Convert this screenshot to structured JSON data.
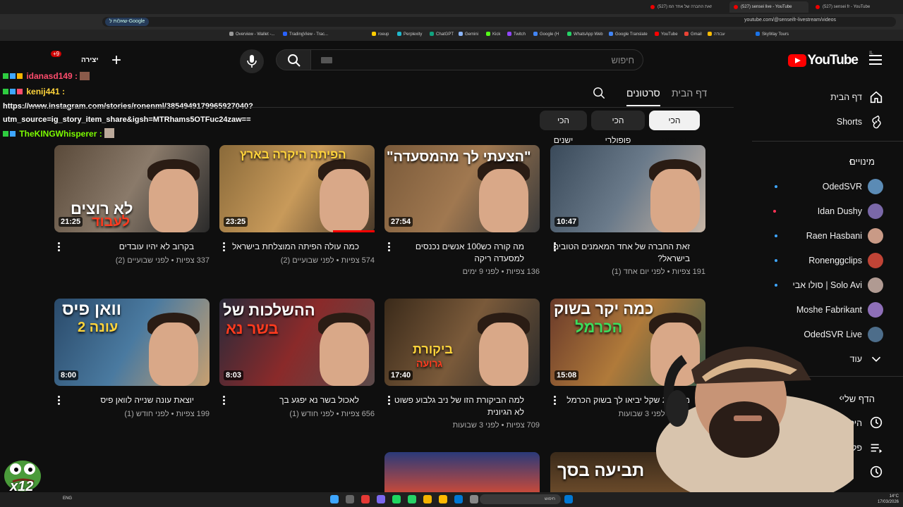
{
  "browser": {
    "tabs": [
      {
        "title": "(527) sensei fr - YouTube",
        "active": false
      },
      {
        "title": "(527) sensei live - YouTube",
        "active": true
      },
      {
        "title": "(527) זאת החברה של אחד המ",
        "active": false
      }
    ],
    "omnibox_chip": "שאלות ל-Google",
    "url": "youtube.com/@senseifr-livestream/videos",
    "bookmarks": [
      {
        "label": "YouTube",
        "color": "#ff0000"
      },
      {
        "label": "Gmail",
        "color": "#ea4335"
      },
      {
        "label": "עבודה",
        "color": "#fbbc04"
      },
      {
        "label": "SkyWay Tours",
        "color": "#1a73e8"
      },
      {
        "label": "Google Translate",
        "color": "#4285f4"
      },
      {
        "label": "WhatsApp Web",
        "color": "#25d366"
      },
      {
        "label": "Google (H",
        "color": "#4285f4"
      },
      {
        "label": "Twitch",
        "color": "#9146ff"
      },
      {
        "label": "Kick",
        "color": "#53fc18"
      },
      {
        "label": "Gemini",
        "color": "#8ab4f8"
      },
      {
        "label": "ChatGPT",
        "color": "#10a37f"
      },
      {
        "label": "Perplexity",
        "color": "#20b8cd"
      },
      {
        "label": "roeup",
        "color": "#ffcc00"
      },
      {
        "label": "TradingView - Trac...",
        "color": "#2962ff"
      },
      {
        "label": "Overview - Wallet -...",
        "color": "#999999"
      }
    ]
  },
  "header": {
    "logo_text": "YouTube",
    "logo_country": "IL",
    "search_placeholder": "חיפוש"
  },
  "chat": {
    "notif_count": "+9",
    "lines": [
      {
        "user": "idanasd149 :",
        "color": "#ff4d6d"
      },
      {
        "user": "kenij441 :",
        "color": "#ffd43b"
      },
      {
        "user": "TheKINGWhisperer :",
        "color": "#7cfc00"
      }
    ],
    "message": "https://www.instagram.com/stories/ronenml/3854949179965927040?utm_source=ig_story_item_share&igsh=MTRhams5OTFuc24zaw==",
    "top_label": "יצירה"
  },
  "channel_tabs": {
    "home": "דף הבית",
    "videos": "סרטונים"
  },
  "chips": {
    "newest": "הכי חדשים",
    "popular": "הכי פופולרי",
    "oldest": "הכי ישנים"
  },
  "videos": [
    {
      "duration": "10:47",
      "title": "זאת החברה של אחד המאמנים הטובים בישראל?",
      "views": "191 צפיות",
      "age": "לפני יום אחד (1)"
    },
    {
      "duration": "27:54",
      "title": "מה קורה כש100 אנשים נכנסים למסעדה ריקה",
      "views": "136 צפיות",
      "age": "לפני 9 ימים"
    },
    {
      "duration": "23:25",
      "title": "כמה עולה הפיתה המוצלחת בישראל",
      "views": "574 צפיות",
      "age": "לפני שבועיים (2)"
    },
    {
      "duration": "21:25",
      "title": "בקרוב לא יהיו עובדים",
      "views": "337 צפיות",
      "age": "לפני שבועיים (2)"
    },
    {
      "duration": "15:08",
      "title": "מה 200 שקל יביאו לך בשוק הכרמל",
      "views": "797 צפיות",
      "age": "לפני 3 שבועות"
    },
    {
      "duration": "17:40",
      "title": "למה הביקורת הזו של ניב גלבוע פשוט לא הגיונית",
      "views": "709 צפיות",
      "age": "לפני 3 שבועות"
    },
    {
      "duration": "8:03",
      "title": "לאכול בשר נא יפגע בך",
      "views": "656 צפיות",
      "age": "לפני חודש (1)"
    },
    {
      "duration": "8:00",
      "title": "יוצאת עונה שנייה לוואן פיס",
      "views": "199 צפיות",
      "age": "לפני חודש (1)"
    }
  ],
  "thumb_text": {
    "v2": "\"הצעתי לך מהמסעדה\"",
    "v3": "הפיתה היקרה בארץ",
    "v4_a": "לא רוצים",
    "v4_b": "לעבוד",
    "v5_a": "כמה יקר בשוק",
    "v5_b": "הכרמל",
    "v6_a": "ביקורת",
    "v6_b": "גרועה",
    "v7_a": "ההשלכות של",
    "v7_b": "בשר נא",
    "v8_a": "וואן פיס",
    "v8_b": "עונה 2",
    "v10": "תביעה בסך"
  },
  "sidebar": {
    "home": "דף הבית",
    "shorts": "Shorts",
    "subs": "מינויים",
    "channels": [
      {
        "name": "OdedSVR",
        "dot": "#3ea6ff",
        "avatar": "#5b8bb5"
      },
      {
        "name": "Idan Dushy",
        "dot": "#ff3355",
        "avatar": "#7a68a8"
      },
      {
        "name": "Raen Hasbani",
        "dot": "#3ea6ff",
        "avatar": "#c99a86"
      },
      {
        "name": "Ronenggclips",
        "dot": "#3ea6ff",
        "avatar": "#c04436"
      },
      {
        "name": "Solo Avi | סולו אבי",
        "dot": "#3ea6ff",
        "avatar": "#b09a92"
      },
      {
        "name": "Moshe Fabrikant",
        "dot": "",
        "avatar": "#8e6fb8"
      },
      {
        "name": "OdedSVR Live",
        "dot": "",
        "avatar": "#4d6d8a"
      }
    ],
    "more": "עוד",
    "you": "הדף שלי",
    "history": "היסטוריה",
    "playlists": "פלייליסטים"
  },
  "taskbar": {
    "search": "חיפוש",
    "lang": "ENG",
    "time": "14°C",
    "date": "17/03/2026"
  }
}
